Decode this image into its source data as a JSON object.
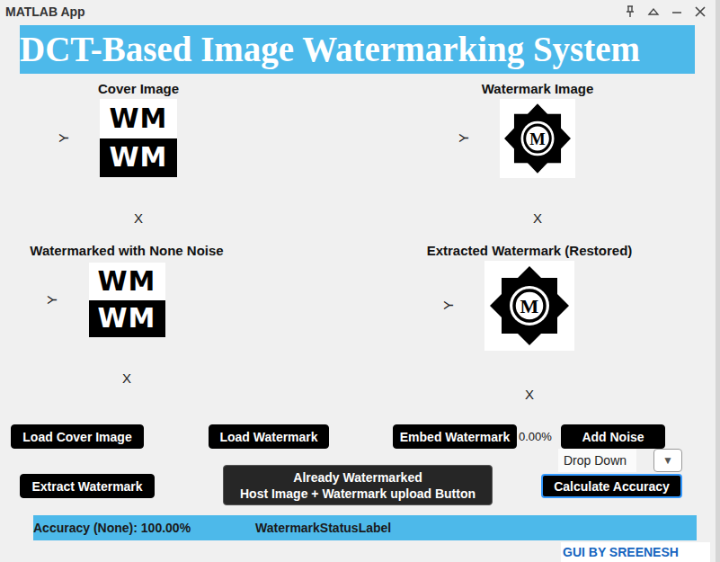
{
  "window": {
    "title": "MATLAB App"
  },
  "banner": {
    "title": "DCT-Based Image Watermarking System"
  },
  "axes": [
    {
      "title": "Cover Image",
      "y_label": "Y",
      "x_label": "X",
      "kind": "text-image",
      "image_text": [
        "WM",
        "WM"
      ]
    },
    {
      "title": "Watermark Image",
      "y_label": "Y",
      "x_label": "X",
      "kind": "seal",
      "image_text": [
        "M"
      ]
    },
    {
      "title": "Watermarked with None Noise",
      "y_label": "Y",
      "x_label": "X",
      "kind": "text-image",
      "image_text": [
        "WM",
        "WM"
      ]
    },
    {
      "title": "Extracted Watermark (Restored)",
      "y_label": "Y",
      "x_label": "X",
      "kind": "seal",
      "image_text": [
        "M"
      ]
    }
  ],
  "buttons": {
    "load_cover": {
      "lines": [
        "Load Cover Image"
      ],
      "focused": false
    },
    "load_watermark": {
      "lines": [
        "Load Watermark"
      ],
      "focused": false
    },
    "embed": {
      "lines": [
        "Embed Watermark"
      ],
      "focused": false
    },
    "add_noise": {
      "lines": [
        "Add Noise"
      ],
      "focused": false
    },
    "extract": {
      "lines": [
        "Extract Watermark"
      ],
      "focused": false
    },
    "already_watermarked": {
      "lines": [
        "Already Watermarked",
        "Host Image + Watermark upload Button"
      ],
      "focused": false
    },
    "calculate": {
      "lines": [
        "Calculate Accuracy"
      ],
      "focused": true
    }
  },
  "embed_accuracy_label": "0.00%",
  "dropdown": {
    "value": "Drop Down",
    "arrow": "▼"
  },
  "status_bar": {
    "accuracy": "Accuracy (None): 100.00%",
    "watermark_status": "WatermarkStatusLabel"
  },
  "credit": "GUI BY SREENESH"
}
